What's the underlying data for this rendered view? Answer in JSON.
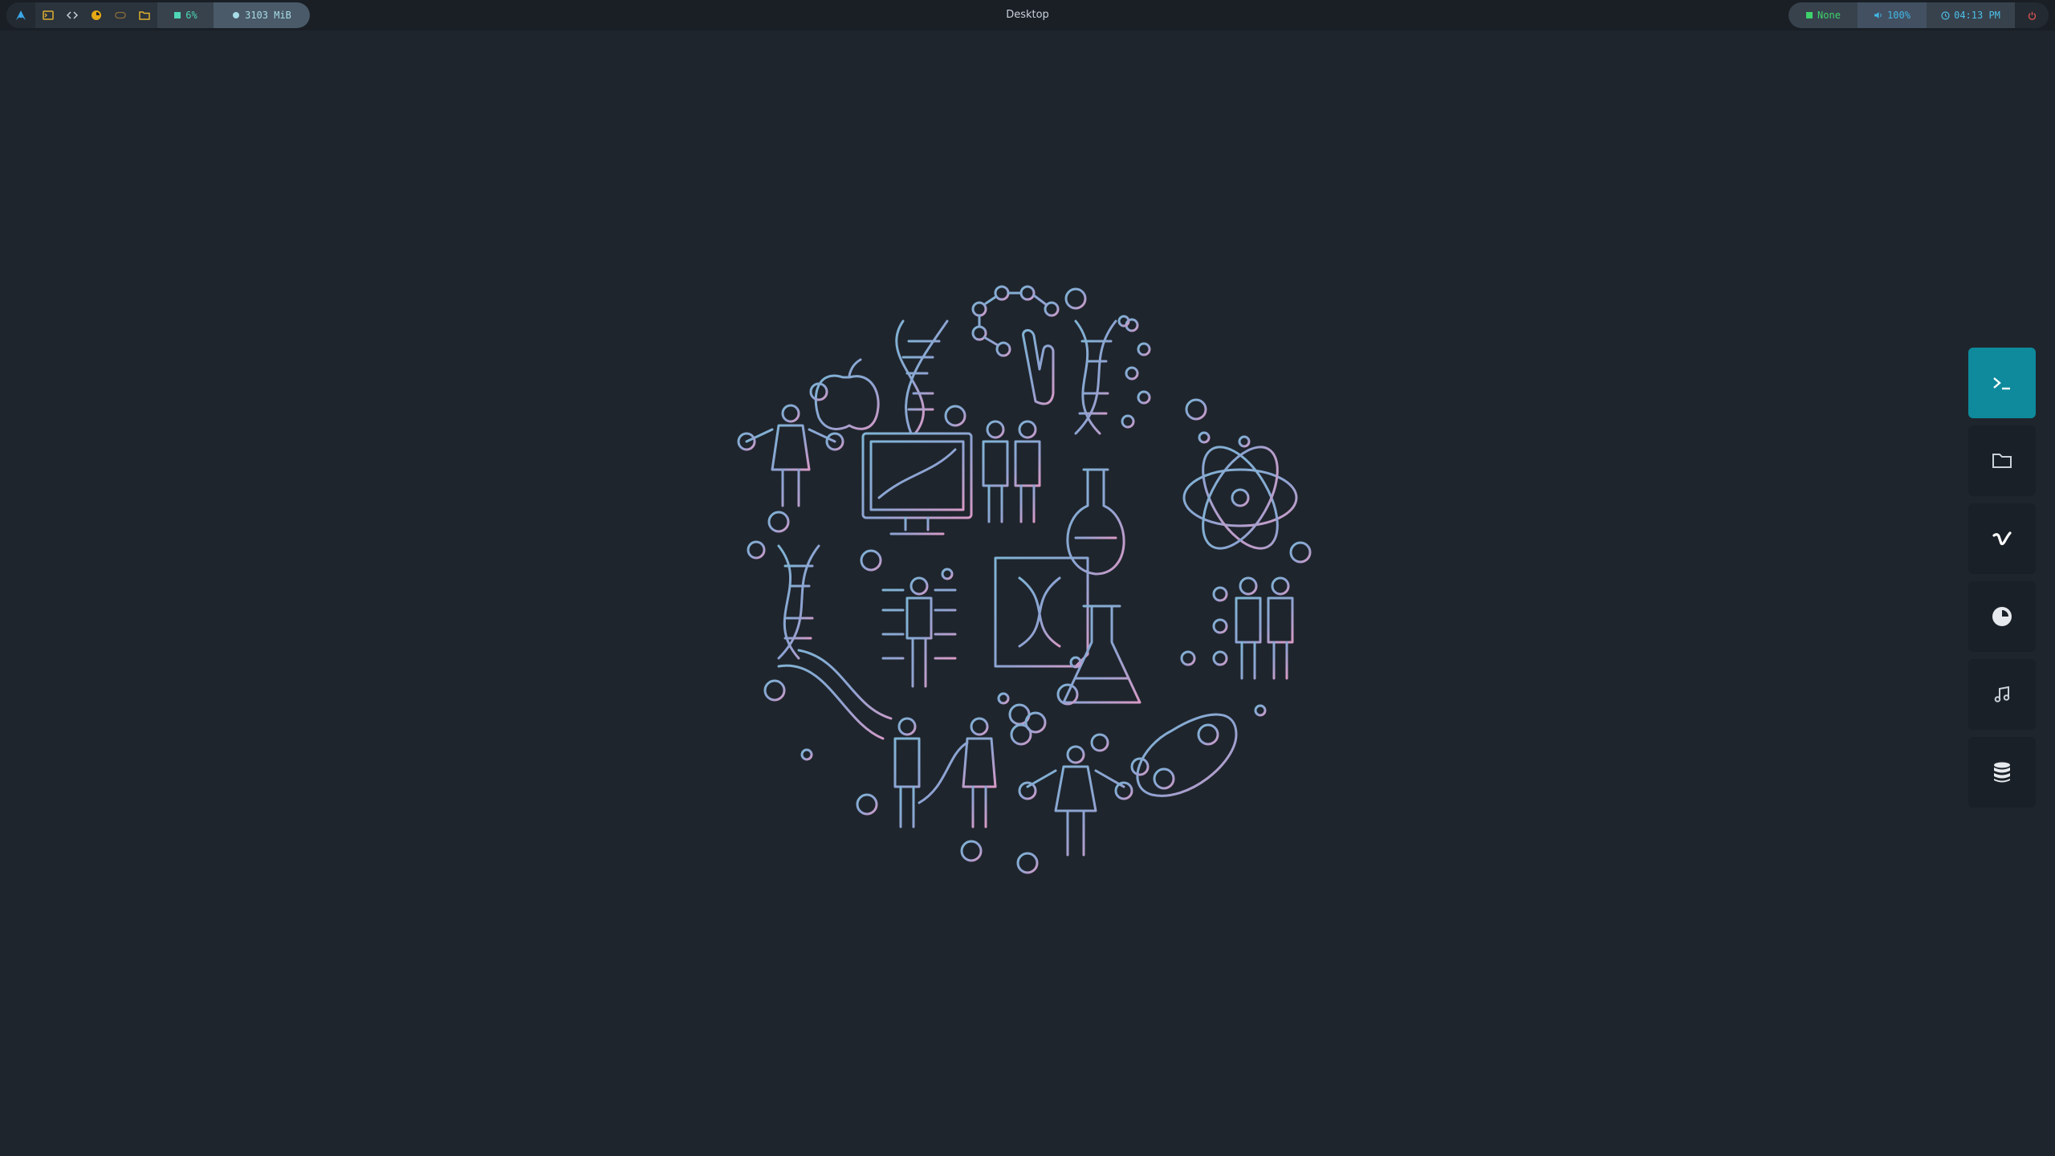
{
  "topbar": {
    "title": "Desktop",
    "cpu": "6%",
    "memory": "3103 MiB",
    "network": "None",
    "volume": "100%",
    "clock": "04:13 PM"
  },
  "icons": {
    "launcher": "arch-icon",
    "apps": [
      "terminal-icon",
      "code-icon",
      "firefox-icon",
      "game-icon",
      "files-icon"
    ],
    "cpu": "cpu-icon",
    "memory": "memory-icon",
    "network": "network-icon",
    "volume": "volume-icon",
    "clock": "clock-icon",
    "power": "power-icon"
  },
  "dock": {
    "items": [
      "terminal-icon",
      "folder-icon",
      "vimeo-icon",
      "browser-icon",
      "music-icon",
      "database-icon"
    ],
    "active_index": 0
  },
  "colors": {
    "background": "#1f252d",
    "accent": "#0e8a9c",
    "wallpaper_blue": "#6fa3c7",
    "wallpaper_pink": "#d79ac6"
  }
}
